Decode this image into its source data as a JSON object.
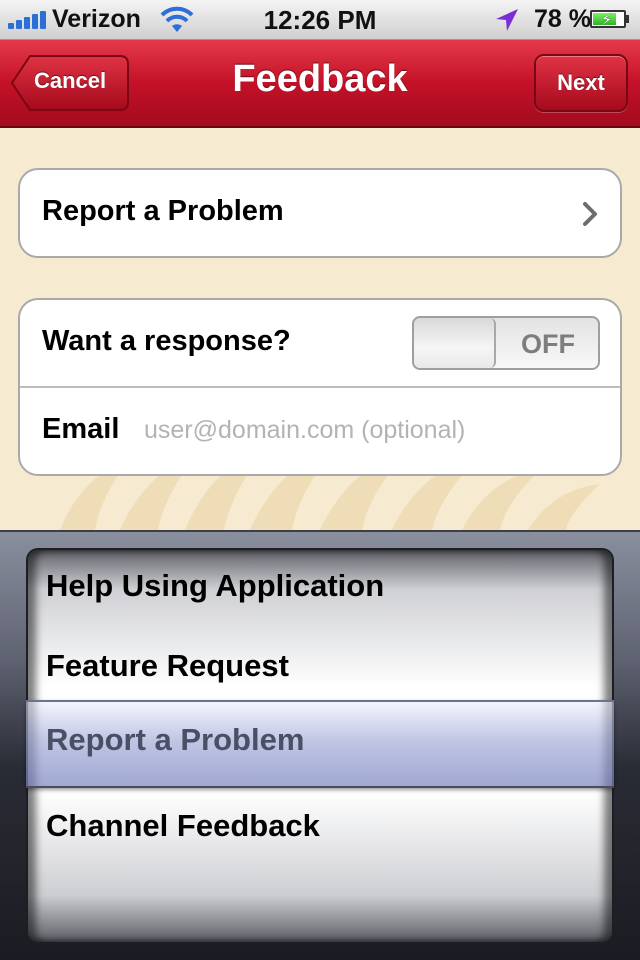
{
  "status_bar": {
    "carrier": "Verizon",
    "time": "12:26 PM",
    "battery_percent": "78 %",
    "battery_level": 0.78,
    "signal_icon": "cellular-signal-icon",
    "wifi_icon": "wifi-icon",
    "location_icon": "location-arrow-icon",
    "battery_icon": "battery-charging-icon"
  },
  "nav": {
    "title": "Feedback",
    "cancel_label": "Cancel",
    "next_label": "Next"
  },
  "form": {
    "category_label": "Report a Problem",
    "response_label": "Want a response?",
    "response_toggle_state": "OFF",
    "email_label": "Email",
    "email_value": "",
    "email_placeholder": "user@domain.com (optional)"
  },
  "picker": {
    "items": [
      "Help Using Application",
      "Feature Request",
      "Report a Problem",
      "Channel Feedback"
    ],
    "selected": "Report a Problem"
  },
  "colors": {
    "nav_red": "#c41128",
    "content_background": "#f6ead0",
    "toggle_text": "#7d7d7d",
    "placeholder_gray": "#b3b3b3"
  }
}
